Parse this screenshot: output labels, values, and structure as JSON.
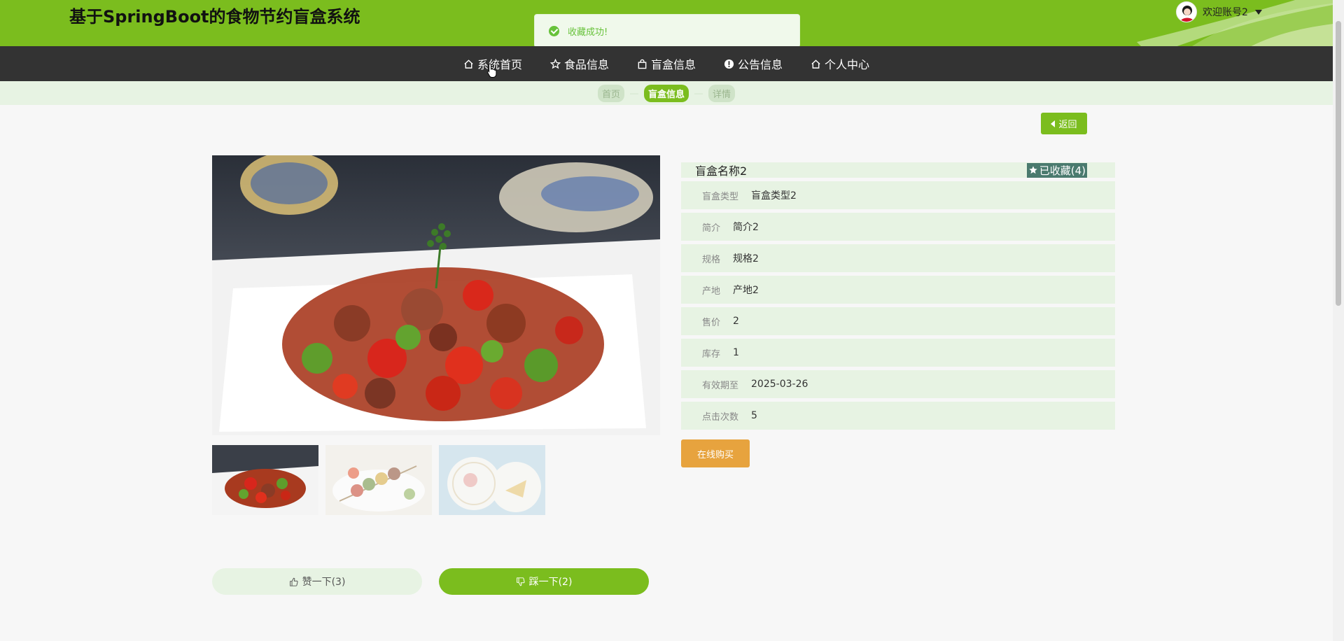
{
  "header": {
    "title": "基于SpringBoot的食物节约盲盒系统",
    "user_label": "欢迎账号2",
    "accent": "#7bbd1e"
  },
  "toast": {
    "message": "收藏成功!",
    "color": "#67c23a"
  },
  "nav": {
    "items": [
      {
        "label": "系统首页",
        "icon": "home-icon"
      },
      {
        "label": "食品信息",
        "icon": "star-icon"
      },
      {
        "label": "盲盒信息",
        "icon": "bag-icon"
      },
      {
        "label": "公告信息",
        "icon": "alert-circle-icon"
      },
      {
        "label": "个人中心",
        "icon": "home-icon"
      }
    ]
  },
  "breadcrumb": {
    "items": [
      "首页",
      "盲盒信息",
      "详情"
    ],
    "active_index": 1
  },
  "back_button": {
    "label": "返回"
  },
  "detail": {
    "name": "盲盒名称2",
    "favorite_label": "已收藏(4)",
    "fields": [
      {
        "key": "盲盒类型",
        "value": "盲盒类型2"
      },
      {
        "key": "简介",
        "value": "简介2"
      },
      {
        "key": "规格",
        "value": "规格2"
      },
      {
        "key": "产地",
        "value": "产地2"
      },
      {
        "key": "售价",
        "value": "2"
      },
      {
        "key": "库存",
        "value": "1"
      },
      {
        "key": "有效期至",
        "value": "2025-03-26"
      },
      {
        "key": "点击次数",
        "value": "5"
      }
    ],
    "buy_label": "在线购买",
    "buy_color": "#e7a33e"
  },
  "votes": {
    "up_label": "赞一下(3)",
    "down_label": "踩一下(2)"
  }
}
